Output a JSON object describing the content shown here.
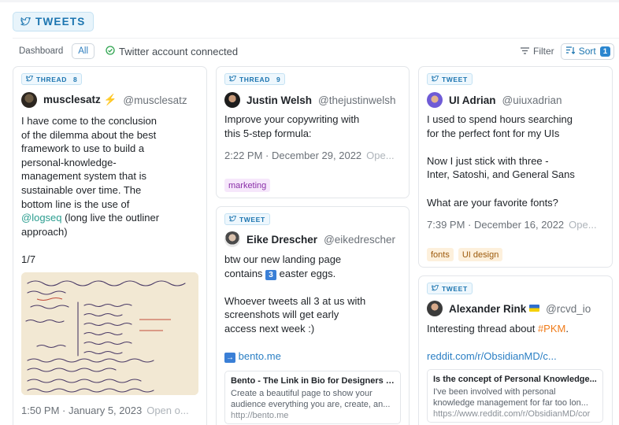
{
  "header": {
    "title": "TWEETS",
    "breadcrumb": "Dashboard",
    "filter_all": "All",
    "status": "Twitter account connected",
    "filter_label": "Filter",
    "sort_label": "Sort",
    "sort_count": "1"
  },
  "cards": {
    "c1": {
      "badge": "THREAD",
      "badge_count": "8",
      "name": "musclesatz",
      "name_emoji": "⚡",
      "handle": "@musclesatz",
      "text_before": "I have come to the conclusion\nof the dilemma about the best\nframework to use to build a\npersonal-knowledge-\nmanagement system that is\nsustainable over time. The\nbottom line is the use of\n",
      "mention": "@logseq",
      "text_after": " (long live the outliner\napproach)\n\n1/7",
      "image_text": [
        "Sinnheit und Vertriebs-Rechnung",
        "Aufgaben",
        "Reisebeschreibungen",
        "Literatur"
      ],
      "time": "1:50 PM · January 5, 2023",
      "open": "Open o..."
    },
    "c2": {
      "badge": "THREAD",
      "badge_count": "9",
      "name": "Justin Welsh",
      "handle": "@thejustinwelsh",
      "text": "Improve your copywriting with\nthis 5-step formula:",
      "time": "2:22 PM · December 29, 2022",
      "open": "Ope...",
      "tags": [
        "marketing"
      ]
    },
    "c3": {
      "badge": "TWEET",
      "name": "UI Adrian",
      "handle": "@uiuxadrian",
      "text": "I used to spend hours searching\nfor the perfect font for my UIs\n\nNow I just stick with three -\nInter, Satoshi, and General Sans\n\nWhat are your favorite fonts?",
      "time": "7:39 PM · December 16, 2022",
      "open": "Ope...",
      "tags": [
        "fonts",
        "UI design"
      ]
    },
    "c4": {
      "badge": "TWEET",
      "name": "Eike Drescher",
      "handle": "@eikedrescher",
      "text_1": "btw our new landing page\ncontains ",
      "keycap": "3️⃣",
      "text_2": " easter eggs.\n\nWhoever tweets all 3 at us with\nscreenshots will get early\naccess next week :)\n\n",
      "arrow": "➡️",
      "link": " bento.me",
      "preview_title": "Bento - The Link in Bio for Designers a...",
      "preview_desc": "Create a beautiful page to show your audience everything you are, create, an...",
      "preview_url": "http://bento.me"
    },
    "c5": {
      "badge": "TWEET",
      "name": "Alexander Rink",
      "name_flag": "🇺🇦",
      "handle": "@rcvd_io",
      "text_before": "Interesting thread about ",
      "hashtag": "#PKM",
      "text_after": ".",
      "link": "reddit.com/r/ObsidianMD/c...",
      "preview_title": "Is the concept of Personal Knowledge...",
      "preview_desc": "I've been involved with personal knowledge management for far too lon...",
      "preview_url": "https://www.reddit.com/r/ObsidianMD/cor"
    }
  },
  "colors": {
    "accent": "#1c75b0",
    "mention": "#2a9d8f",
    "hashtag": "#f07c1a",
    "tag_purple": "#8a2fa8",
    "tag_orange": "#9c5a0d"
  }
}
